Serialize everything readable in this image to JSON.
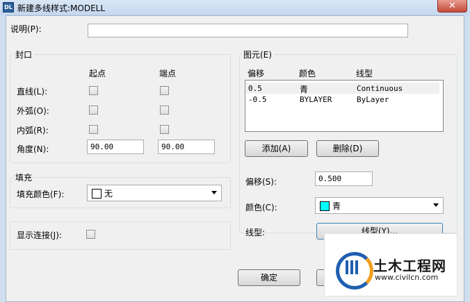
{
  "window": {
    "title": "新建多线样式:MODELL",
    "app_icon": "autocad-icon",
    "close_glyph": "✕"
  },
  "description": {
    "label": "说明(P):",
    "value": ""
  },
  "caps": {
    "group_label": "封口",
    "col_start": "起点",
    "col_end": "端点",
    "rows": [
      {
        "label": "直线(L):",
        "start": false,
        "end": false
      },
      {
        "label": "外弧(O):",
        "start": false,
        "end": false
      },
      {
        "label": "内弧(R):",
        "start": false,
        "end": false
      }
    ],
    "angle_label": "角度(N):",
    "angle_start": "90.00",
    "angle_end": "90.00"
  },
  "fill": {
    "group_label": "填充",
    "color_label": "填充颜色(F):",
    "color_value": "无",
    "color_swatch": "#ffffff"
  },
  "joints": {
    "label": "显示连接(J):",
    "checked": false
  },
  "elements": {
    "group_label": "图元(E)",
    "headers": {
      "offset": "偏移",
      "color": "颜色",
      "linetype": "线型"
    },
    "rows": [
      {
        "offset": "0.5",
        "color": "青",
        "linetype": "Continuous",
        "selected": true
      },
      {
        "offset": "-0.5",
        "color": "BYLAYER",
        "linetype": "ByLayer",
        "selected": false
      }
    ],
    "add_button": "添加(A)",
    "delete_button": "删除(D)",
    "offset_label": "偏移(S):",
    "offset_value": "0.500",
    "color_label": "颜色(C):",
    "color_value": "青",
    "color_swatch": "#00ffff",
    "linetype_label": "线型:",
    "linetype_button": "线型(Y)..."
  },
  "buttons": {
    "ok": "确定"
  },
  "watermark": {
    "name": "土木工程网",
    "url": "www.civilcn.com"
  }
}
